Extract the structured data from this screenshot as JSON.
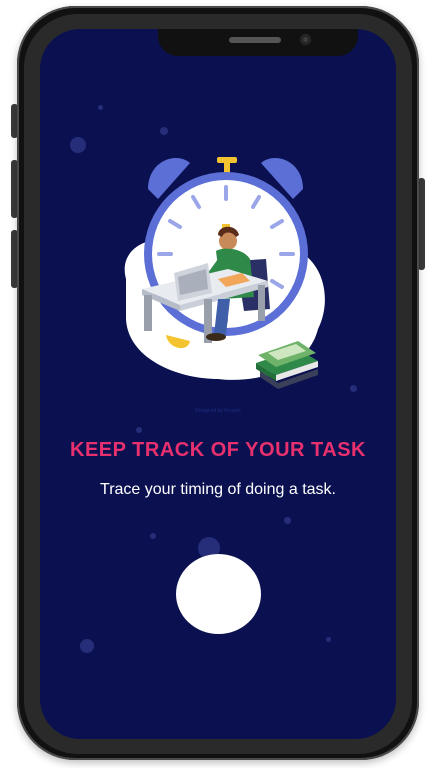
{
  "onboarding": {
    "title": "KEEP TRACK OF YOUR TASK",
    "subtitle": "Trace your timing of doing a task.",
    "illustration_credit": "Designed by Freepik"
  },
  "colors": {
    "screen_background": "#0b1150",
    "title": "#e8306f",
    "subtitle": "#ffffff",
    "next_button": "#ffffff",
    "clock": "#5b6fd6"
  },
  "icons": {
    "illustration": "alarm-clock-with-person-at-desk",
    "next_button": "circle"
  }
}
